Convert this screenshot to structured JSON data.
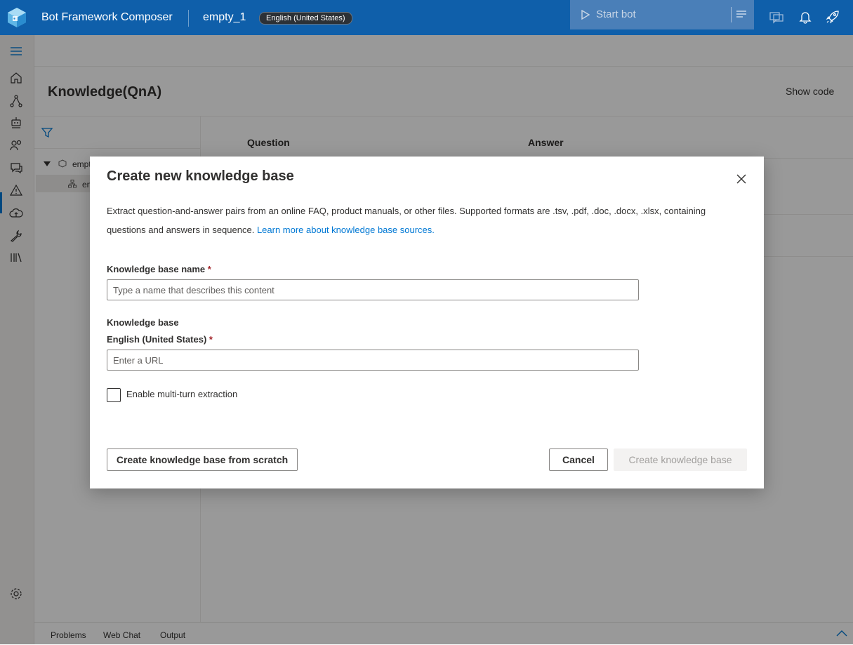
{
  "topbar": {
    "app_title": "Bot Framework Composer",
    "bot_name": "empty_1",
    "locale": "English (United States)",
    "start_bot_label": "Start bot"
  },
  "page": {
    "title": "Knowledge(QnA)",
    "show_code_label": "Show code"
  },
  "tree": {
    "bot_label": "empt",
    "dialog_label": "en"
  },
  "table": {
    "columns": [
      "Question",
      "Answer"
    ]
  },
  "bottom_tabs": [
    "Problems",
    "Web Chat",
    "Output"
  ],
  "modal": {
    "title": "Create new knowledge base",
    "description": "Extract question-and-answer pairs from an online FAQ, product manuals, or other files. Supported formats are .tsv, .pdf, .doc, .docx, .xlsx, containing questions and answers in sequence.",
    "learn_more_link": "Learn more about knowledge base sources.",
    "name_label": "Knowledge base name",
    "name_placeholder": "Type a name that describes this content",
    "name_value": "",
    "kb_section_label": "Knowledge base",
    "kb_locale_label": "English (United States)",
    "url_placeholder": "Enter a URL",
    "url_value": "",
    "required_marker": "*",
    "multiturn_label": "Enable multi-turn extraction",
    "multiturn_checked": false,
    "scratch_button": "Create knowledge base from scratch",
    "cancel_button": "Cancel",
    "create_button": "Create knowledge base"
  },
  "colors": {
    "topbar": "#0f5faa",
    "accent": "#0078d4",
    "required": "#a4262c"
  }
}
